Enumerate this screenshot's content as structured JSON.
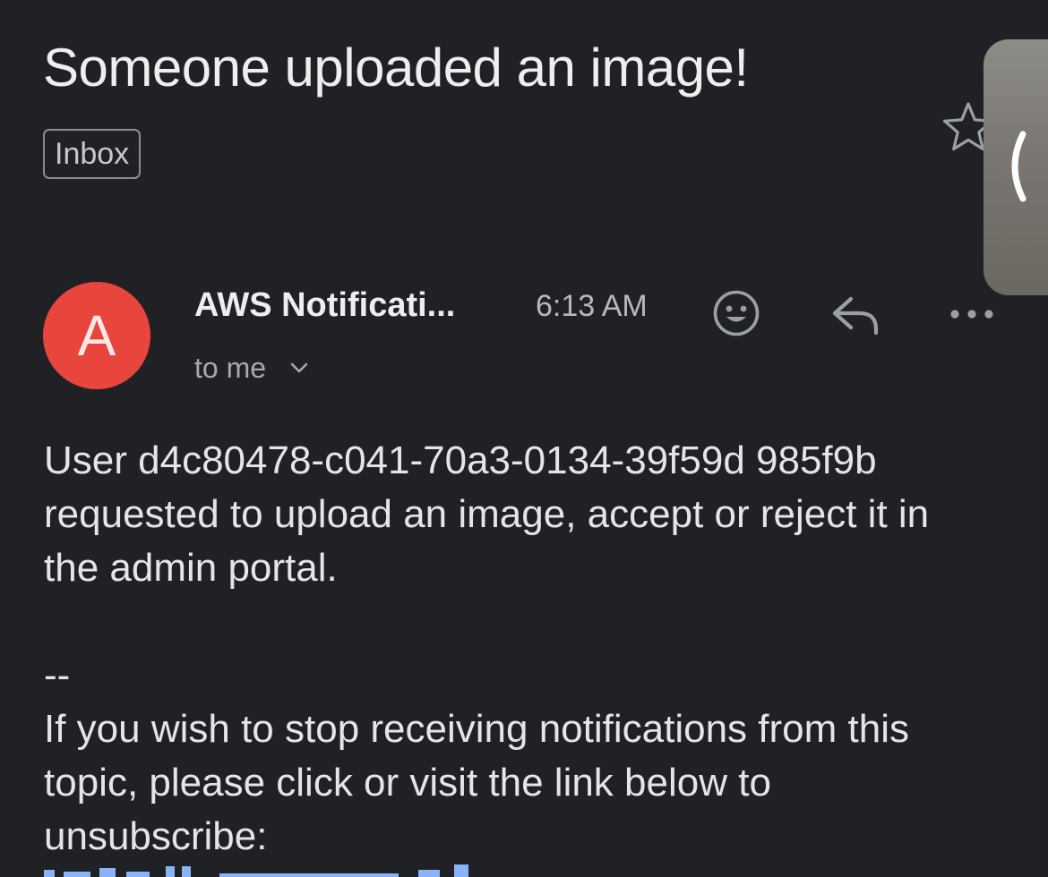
{
  "email": {
    "subject": "Someone uploaded an image!",
    "label": "Inbox",
    "sender": {
      "avatar_letter": "A",
      "name": "AWS Notificati...",
      "time": "6:13 AM",
      "recipient": "to me"
    },
    "body": "User d4c80478-c041-70a3-0134-39f59d 985f9b requested to upload an image, accept or reject it in the admin portal.",
    "signature_separator": "--",
    "footer": "If you wish to stop receiving notifications from this topic, please click or visit the link below to unsubscribe:"
  },
  "icons": {
    "star": "star-outline-icon",
    "collapse": "chevron-left-icon",
    "emoji": "emoji-reaction-icon",
    "reply": "reply-icon",
    "more": "more-horizontal-icon",
    "recipient_details": "chevron-down-icon"
  },
  "colors": {
    "background": "#202124",
    "avatar": "#e8453c",
    "link": "#8ab4f8"
  }
}
